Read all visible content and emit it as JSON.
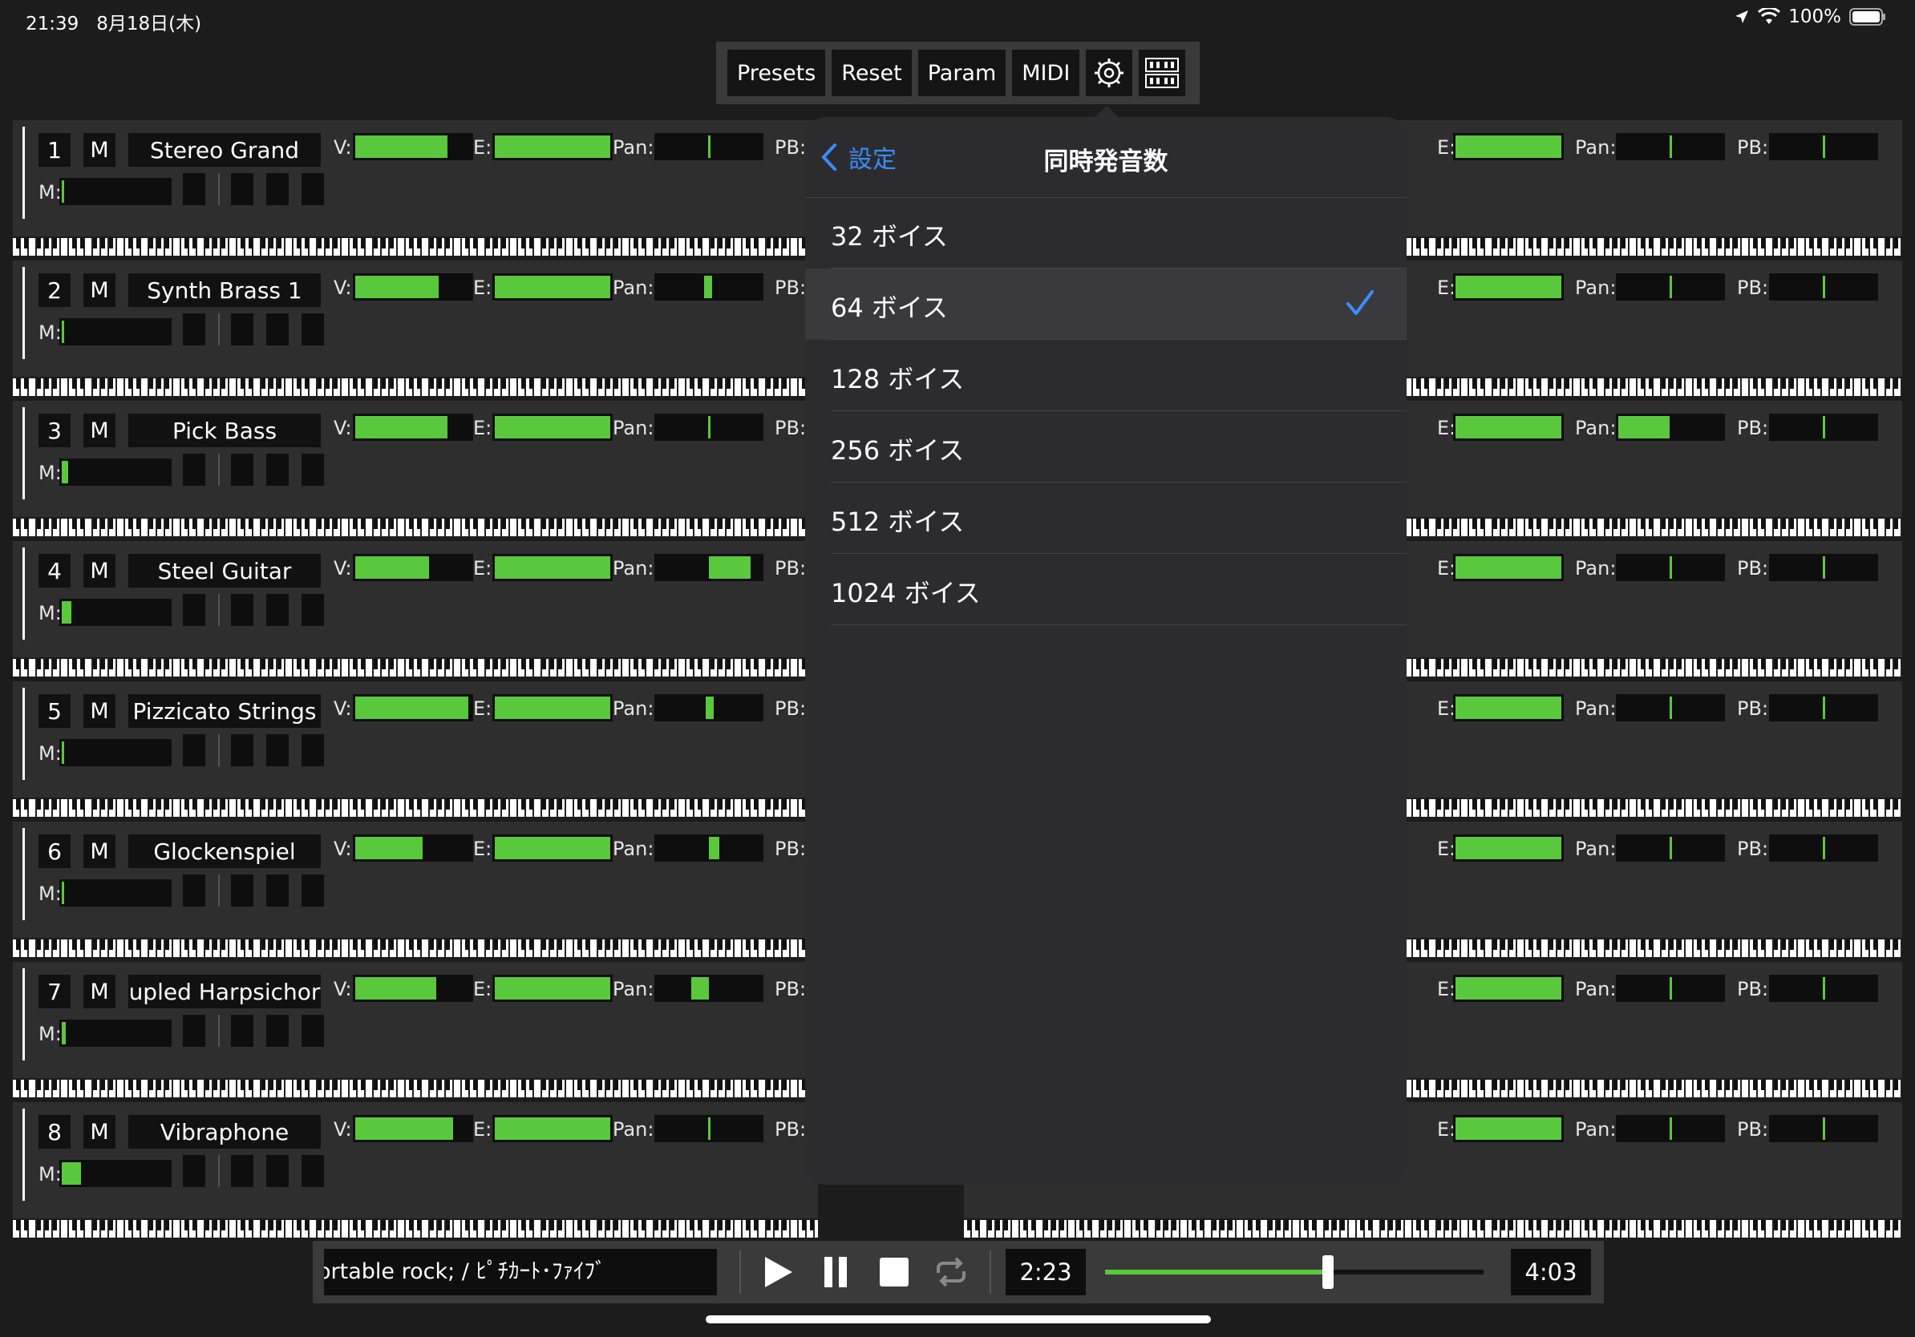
{
  "status_bar": {
    "time": "21:39",
    "date": "8月18日(木)",
    "battery": "100%"
  },
  "toolbar": {
    "presets": "Presets",
    "reset": "Reset",
    "param": "Param",
    "midi": "MIDI"
  },
  "labels": {
    "v": "V:",
    "e": "E:",
    "pan": "Pan:",
    "pb": "PB:",
    "m": "M:",
    "mute": "M"
  },
  "channels": [
    {
      "num": "1",
      "name": "Stereo Grand",
      "v": 0.8,
      "e": 1.0,
      "pan": 0.5,
      "m": 0.02,
      "r_e": 1.0,
      "r_pan": 0.5
    },
    {
      "num": "2",
      "name": "Synth Brass 1",
      "v": 0.72,
      "e": 1.0,
      "pan": 0.45,
      "m": 0.02,
      "r_e": 1.0,
      "r_pan": 0.5
    },
    {
      "num": "3",
      "name": "Pick Bass",
      "v": 0.8,
      "e": 1.0,
      "pan": 0.5,
      "m": 0.06,
      "r_e": 1.0,
      "r_pan": 0.5
    },
    {
      "num": "4",
      "name": "Steel Guitar",
      "v": 0.64,
      "e": 1.0,
      "pan": 0.9,
      "m": 0.09,
      "r_e": 1.0,
      "r_pan": 0.5
    },
    {
      "num": "5",
      "name": "Pizzicato Strings",
      "v": 0.98,
      "e": 1.0,
      "pan": 0.47,
      "m": 0.02,
      "r_e": 1.0,
      "r_pan": 0.5
    },
    {
      "num": "6",
      "name": "Glockenspiel",
      "v": 0.58,
      "e": 1.0,
      "pan": 0.6,
      "m": 0.02,
      "r_e": 1.0,
      "r_pan": 0.5
    },
    {
      "num": "7",
      "name": "upled Harpsichor",
      "v": 0.7,
      "e": 1.0,
      "pan": 0.33,
      "m": 0.04,
      "r_e": 1.0,
      "r_pan": 0.5
    },
    {
      "num": "8",
      "name": "Vibraphone",
      "v": 0.85,
      "e": 1.0,
      "pan": 0.5,
      "m": 0.18,
      "r_e": 1.0,
      "r_pan": 0.5
    }
  ],
  "right_pan_fill_row3": 0.5,
  "popover": {
    "back_label": "設定",
    "title": "同時発音数",
    "options": [
      "32 ボイス",
      "64 ボイス",
      "128 ボイス",
      "256 ボイス",
      "512 ボイス",
      "1024 ボイス"
    ],
    "selected_index": 1
  },
  "transport": {
    "song": "ortable rock; / ﾋﾟﾁｶｰﾄ･ﾌｧｲﾌﾞ",
    "elapsed": "2:23",
    "total": "4:03",
    "progress": 0.59
  },
  "colors": {
    "accent_green": "#5ac83c",
    "link_blue": "#3a8cff"
  }
}
